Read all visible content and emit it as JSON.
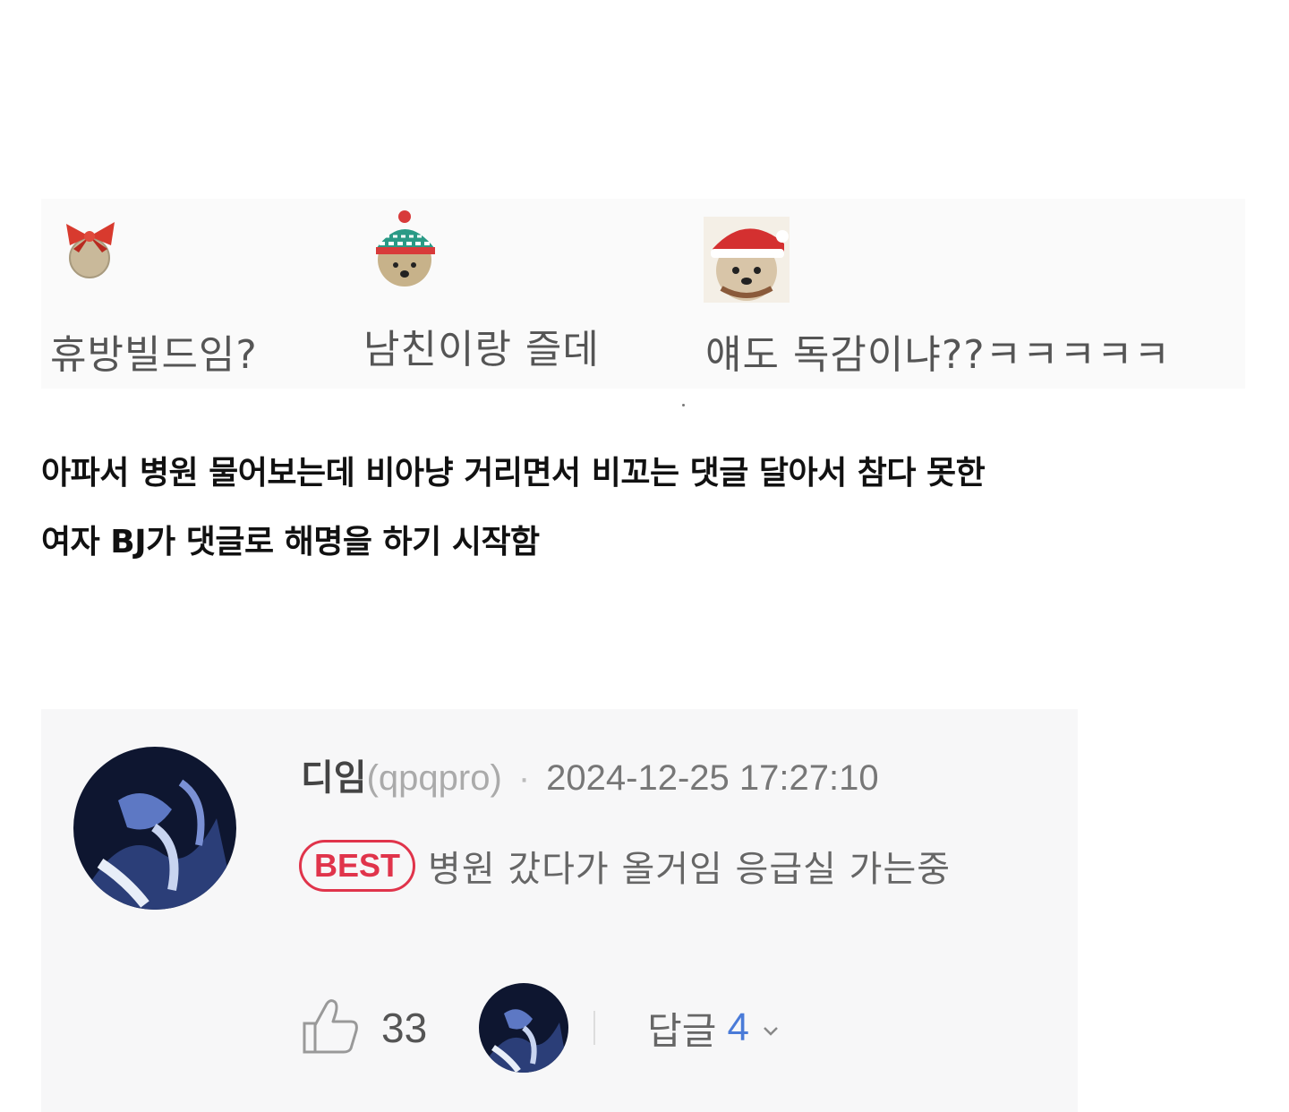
{
  "top_comments": [
    {
      "icon": "ribbon-bell-icon",
      "text": "휴방빌드임?"
    },
    {
      "icon": "beanie-dog-icon",
      "text": "남친이랑 즐데"
    },
    {
      "icon": "santa-dog-icon",
      "text": "얘도 독감이냐??ㅋㅋㅋㅋㅋ"
    }
  ],
  "caption": {
    "line1": "아파서 병원 물어보는데 비아냥 거리면서 비꼬는 댓글 달아서 참다 못한",
    "line2": "여자 BJ가 댓글로 해명을 하기 시작함"
  },
  "comment": {
    "nickname": "디임",
    "user_id": "(qpqpro)",
    "separator": "·",
    "timestamp": "2024-12-25 17:27:10",
    "badge": "BEST",
    "body": "병원 갔다가 올거임 응급실 가는중",
    "like_count": "33",
    "reply_label": "답글",
    "reply_count": "4"
  },
  "colors": {
    "best_red": "#e0344b",
    "reply_blue": "#4a7bd8",
    "card_bg": "#f7f7f8"
  }
}
